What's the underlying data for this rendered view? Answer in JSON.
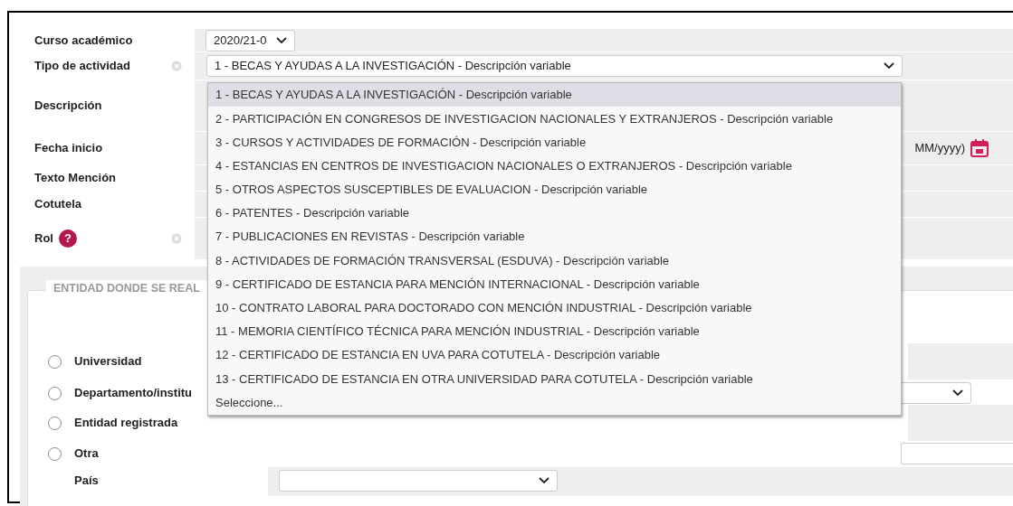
{
  "form": {
    "fields": [
      {
        "label": "Curso académico",
        "kind": "select",
        "value": "2020/21-0",
        "info_icon": false,
        "help_icon": false
      },
      {
        "label": "Tipo de actividad",
        "kind": "select_wide",
        "value": "1 - BECAS Y AYUDAS A LA INVESTIGACIÓN - Descripción variable",
        "info_icon": true,
        "help_icon": false
      },
      {
        "label": "Descripción",
        "kind": "textarea",
        "info_icon": false,
        "help_icon": false
      },
      {
        "label": "Fecha inicio",
        "kind": "date",
        "hint": "MM/yyyy)",
        "info_icon": false,
        "help_icon": false
      },
      {
        "label": "Texto Mención",
        "kind": "text",
        "info_icon": false,
        "help_icon": false
      },
      {
        "label": "Cotutela",
        "kind": "text",
        "info_icon": false,
        "help_icon": false
      },
      {
        "label": "Rol",
        "kind": "tall",
        "info_icon": true,
        "help_icon": true,
        "help_text": "?"
      }
    ]
  },
  "dropdown": {
    "options": [
      {
        "label": "1 - BECAS Y AYUDAS A LA INVESTIGACIÓN - Descripción variable",
        "selected": true
      },
      {
        "label": "2 - PARTICIPACIÓN EN CONGRESOS DE INVESTIGACION NACIONALES Y EXTRANJEROS - Descripción variable",
        "selected": false
      },
      {
        "label": "3 - CURSOS Y ACTIVIDADES DE FORMACIÓN - Descripción variable",
        "selected": false
      },
      {
        "label": "4 - ESTANCIAS EN CENTROS DE INVESTIGACION NACIONALES O EXTRANJEROS - Descripción variable",
        "selected": false
      },
      {
        "label": "5 - OTROS ASPECTOS SUSCEPTIBLES DE EVALUACION - Descripción variable",
        "selected": false
      },
      {
        "label": "6 - PATENTES - Descripción variable",
        "selected": false
      },
      {
        "label": "7 - PUBLICACIONES EN REVISTAS - Descripción variable",
        "selected": false
      },
      {
        "label": "8 - ACTIVIDADES DE FORMACIÓN TRANSVERSAL (ESDUVA) - Descripción variable",
        "selected": false
      },
      {
        "label": "9 - CERTIFICADO DE ESTANCIA PARA MENCIÓN INTERNACIONAL - Descripción variable",
        "selected": false
      },
      {
        "label": "10 - CONTRATO LABORAL PARA DOCTORADO CON MENCIÓN INDUSTRIAL - Descripción variable",
        "selected": false
      },
      {
        "label": "11 - MEMORIA CIENTÍFICO TÉCNICA PARA MENCIÓN INDUSTRIAL - Descripción variable",
        "selected": false
      },
      {
        "label": "12 - CERTIFICADO DE ESTANCIA EN UVA PARA COTUTELA - Descripción variable",
        "selected": false
      },
      {
        "label": "13 - CERTIFICADO DE ESTANCIA EN OTRA UNIVERSIDAD PARA COTUTELA - Descripción variable",
        "selected": false
      },
      {
        "label": "Seleccione...",
        "selected": false
      }
    ]
  },
  "entity_section": {
    "legend": "ENTIDAD DONDE SE REAL",
    "options": [
      {
        "label": "Universidad",
        "selected": false,
        "kind": "plain"
      },
      {
        "label": "Departamento/institu",
        "selected": false,
        "kind": "select"
      },
      {
        "label": "Entidad registrada",
        "selected": false,
        "kind": "plain"
      },
      {
        "label": "Otra",
        "selected": false,
        "kind": "input"
      }
    ],
    "country": {
      "label": "País"
    }
  }
}
